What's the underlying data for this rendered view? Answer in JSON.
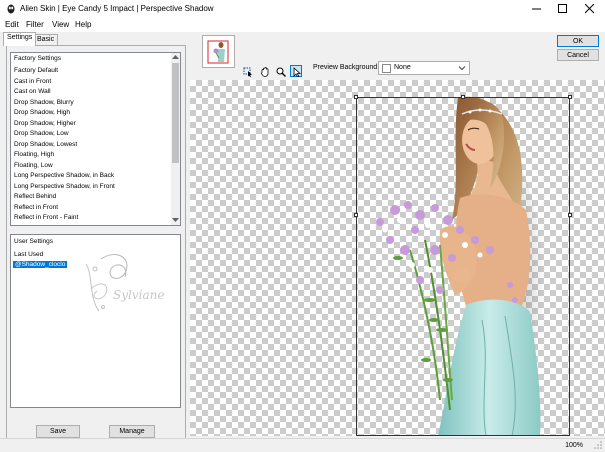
{
  "window": {
    "title": "Alien Skin | Eye Candy 5 Impact | Perspective Shadow",
    "minimize_icon": "minimize-icon",
    "maximize_icon": "maximize-icon",
    "close_icon": "close-icon"
  },
  "menu": {
    "items": [
      "Edit",
      "Filter",
      "View",
      "Help"
    ]
  },
  "tabs": [
    "Settings",
    "Basic"
  ],
  "factory": {
    "header": "Factory Settings",
    "items": [
      "Factory Default",
      "Cast in Front",
      "Cast on Wall",
      "Drop Shadow, Blurry",
      "Drop Shadow, High",
      "Drop Shadow, Higher",
      "Drop Shadow, Low",
      "Drop Shadow, Lowest",
      "Floating, High",
      "Floating, Low",
      "Long Perspective Shadow, in Back",
      "Long Perspective Shadow, in Front",
      "Reflect Behind",
      "Reflect in Front",
      "Reflect in Front - Faint"
    ]
  },
  "user": {
    "header": "User Settings",
    "last_used": "Last Used",
    "selected_item": "@Shadow_cloclo",
    "watermark": "Sylviane"
  },
  "buttons": {
    "save": "Save",
    "manage": "Manage",
    "ok": "OK",
    "cancel": "Cancel"
  },
  "preview_background": {
    "label": "Preview Background:",
    "value": "None"
  },
  "tools": [
    "bounding-box-tool-icon",
    "hand-tool-icon",
    "zoom-tool-icon",
    "select-tool-icon"
  ],
  "status": {
    "zoom": "100%"
  },
  "colors": {
    "selection": "#0078d7",
    "checker": "#cccccc",
    "dress": "#a8d8d4",
    "hair": "#7a4a28"
  }
}
